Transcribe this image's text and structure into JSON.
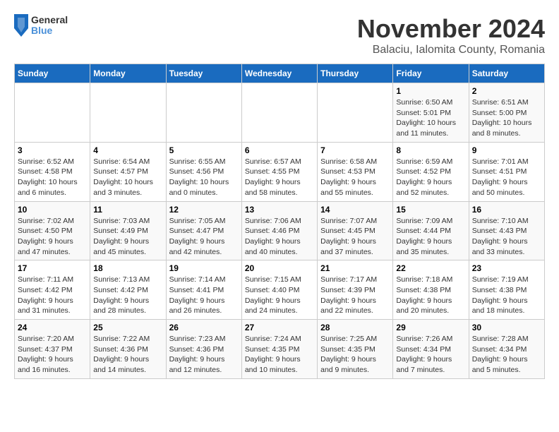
{
  "header": {
    "logo_line1": "General",
    "logo_line2": "Blue",
    "title": "November 2024",
    "subtitle": "Balaciu, Ialomita County, Romania"
  },
  "weekdays": [
    "Sunday",
    "Monday",
    "Tuesday",
    "Wednesday",
    "Thursday",
    "Friday",
    "Saturday"
  ],
  "weeks": [
    [
      {
        "day": "",
        "info": ""
      },
      {
        "day": "",
        "info": ""
      },
      {
        "day": "",
        "info": ""
      },
      {
        "day": "",
        "info": ""
      },
      {
        "day": "",
        "info": ""
      },
      {
        "day": "1",
        "info": "Sunrise: 6:50 AM\nSunset: 5:01 PM\nDaylight: 10 hours and 11 minutes."
      },
      {
        "day": "2",
        "info": "Sunrise: 6:51 AM\nSunset: 5:00 PM\nDaylight: 10 hours and 8 minutes."
      }
    ],
    [
      {
        "day": "3",
        "info": "Sunrise: 6:52 AM\nSunset: 4:58 PM\nDaylight: 10 hours and 6 minutes."
      },
      {
        "day": "4",
        "info": "Sunrise: 6:54 AM\nSunset: 4:57 PM\nDaylight: 10 hours and 3 minutes."
      },
      {
        "day": "5",
        "info": "Sunrise: 6:55 AM\nSunset: 4:56 PM\nDaylight: 10 hours and 0 minutes."
      },
      {
        "day": "6",
        "info": "Sunrise: 6:57 AM\nSunset: 4:55 PM\nDaylight: 9 hours and 58 minutes."
      },
      {
        "day": "7",
        "info": "Sunrise: 6:58 AM\nSunset: 4:53 PM\nDaylight: 9 hours and 55 minutes."
      },
      {
        "day": "8",
        "info": "Sunrise: 6:59 AM\nSunset: 4:52 PM\nDaylight: 9 hours and 52 minutes."
      },
      {
        "day": "9",
        "info": "Sunrise: 7:01 AM\nSunset: 4:51 PM\nDaylight: 9 hours and 50 minutes."
      }
    ],
    [
      {
        "day": "10",
        "info": "Sunrise: 7:02 AM\nSunset: 4:50 PM\nDaylight: 9 hours and 47 minutes."
      },
      {
        "day": "11",
        "info": "Sunrise: 7:03 AM\nSunset: 4:49 PM\nDaylight: 9 hours and 45 minutes."
      },
      {
        "day": "12",
        "info": "Sunrise: 7:05 AM\nSunset: 4:47 PM\nDaylight: 9 hours and 42 minutes."
      },
      {
        "day": "13",
        "info": "Sunrise: 7:06 AM\nSunset: 4:46 PM\nDaylight: 9 hours and 40 minutes."
      },
      {
        "day": "14",
        "info": "Sunrise: 7:07 AM\nSunset: 4:45 PM\nDaylight: 9 hours and 37 minutes."
      },
      {
        "day": "15",
        "info": "Sunrise: 7:09 AM\nSunset: 4:44 PM\nDaylight: 9 hours and 35 minutes."
      },
      {
        "day": "16",
        "info": "Sunrise: 7:10 AM\nSunset: 4:43 PM\nDaylight: 9 hours and 33 minutes."
      }
    ],
    [
      {
        "day": "17",
        "info": "Sunrise: 7:11 AM\nSunset: 4:42 PM\nDaylight: 9 hours and 31 minutes."
      },
      {
        "day": "18",
        "info": "Sunrise: 7:13 AM\nSunset: 4:42 PM\nDaylight: 9 hours and 28 minutes."
      },
      {
        "day": "19",
        "info": "Sunrise: 7:14 AM\nSunset: 4:41 PM\nDaylight: 9 hours and 26 minutes."
      },
      {
        "day": "20",
        "info": "Sunrise: 7:15 AM\nSunset: 4:40 PM\nDaylight: 9 hours and 24 minutes."
      },
      {
        "day": "21",
        "info": "Sunrise: 7:17 AM\nSunset: 4:39 PM\nDaylight: 9 hours and 22 minutes."
      },
      {
        "day": "22",
        "info": "Sunrise: 7:18 AM\nSunset: 4:38 PM\nDaylight: 9 hours and 20 minutes."
      },
      {
        "day": "23",
        "info": "Sunrise: 7:19 AM\nSunset: 4:38 PM\nDaylight: 9 hours and 18 minutes."
      }
    ],
    [
      {
        "day": "24",
        "info": "Sunrise: 7:20 AM\nSunset: 4:37 PM\nDaylight: 9 hours and 16 minutes."
      },
      {
        "day": "25",
        "info": "Sunrise: 7:22 AM\nSunset: 4:36 PM\nDaylight: 9 hours and 14 minutes."
      },
      {
        "day": "26",
        "info": "Sunrise: 7:23 AM\nSunset: 4:36 PM\nDaylight: 9 hours and 12 minutes."
      },
      {
        "day": "27",
        "info": "Sunrise: 7:24 AM\nSunset: 4:35 PM\nDaylight: 9 hours and 10 minutes."
      },
      {
        "day": "28",
        "info": "Sunrise: 7:25 AM\nSunset: 4:35 PM\nDaylight: 9 hours and 9 minutes."
      },
      {
        "day": "29",
        "info": "Sunrise: 7:26 AM\nSunset: 4:34 PM\nDaylight: 9 hours and 7 minutes."
      },
      {
        "day": "30",
        "info": "Sunrise: 7:28 AM\nSunset: 4:34 PM\nDaylight: 9 hours and 5 minutes."
      }
    ]
  ]
}
